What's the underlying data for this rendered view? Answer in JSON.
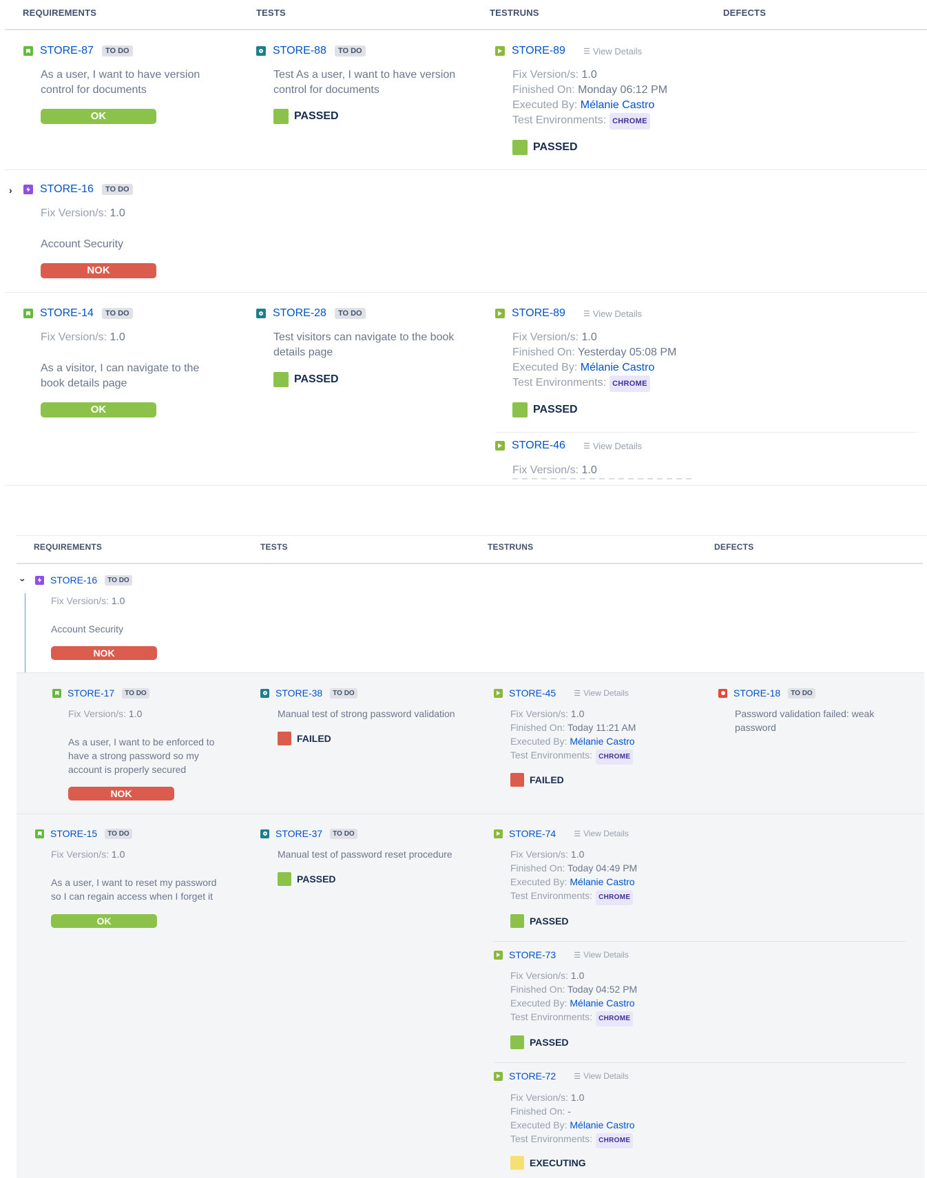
{
  "panel1": {
    "headers": {
      "requirements": "REQUIREMENTS",
      "tests": "TESTS",
      "testruns": "TESTRUNS",
      "defects": "DEFECTS"
    },
    "rows": [
      {
        "req": {
          "key": "STORE-87",
          "status": "TO DO",
          "text1": "As a user, I want to have version",
          "text2": "control for documents",
          "result": "OK"
        },
        "test": {
          "key": "STORE-88",
          "status": "TO DO",
          "text1": "Test As a user, I want to have version",
          "text2": "control for documents",
          "result": "PASSED"
        },
        "run": {
          "key": "STORE-89",
          "view": "View Details",
          "fix_label": "Fix Version/s:",
          "fix": "1.0",
          "fin_label": "Finished On:",
          "fin": "Monday 06:12 PM",
          "exec_label": "Executed By:",
          "user": "Mélanie Castro",
          "env_label": "Test Environments:",
          "env": "CHROME",
          "result": "PASSED"
        }
      },
      {
        "req": {
          "key": "STORE-16",
          "status": "TO DO",
          "fix_label": "Fix Version/s:",
          "fix": "1.0",
          "text1": "Account Security",
          "result": "NOK"
        }
      },
      {
        "req": {
          "key": "STORE-14",
          "status": "TO DO",
          "fix_label": "Fix Version/s:",
          "fix": "1.0",
          "text1": "As a visitor, I can navigate to the",
          "text2": "book details page",
          "result": "OK"
        },
        "test": {
          "key": "STORE-28",
          "status": "TO DO",
          "text1": "Test visitors can navigate to the book",
          "text2": "details page",
          "result": "PASSED"
        },
        "run": {
          "key": "STORE-89",
          "view": "View Details",
          "fix_label": "Fix Version/s:",
          "fix": "1.0",
          "fin_label": "Finished On:",
          "fin": "Yesterday 05:08 PM",
          "exec_label": "Executed By:",
          "user": "Mélanie Castro",
          "env_label": "Test Environments:",
          "env": "CHROME",
          "result": "PASSED"
        },
        "run2": {
          "key": "STORE-46",
          "view": "View Details",
          "fix_label": "Fix Version/s:",
          "fix": "1.0"
        }
      }
    ]
  },
  "panel2": {
    "headers": {
      "requirements": "REQUIREMENTS",
      "tests": "TESTS",
      "testruns": "TESTRUNS",
      "defects": "DEFECTS"
    },
    "epic": {
      "key": "STORE-16",
      "status": "TO DO",
      "fix_label": "Fix Version/s:",
      "fix": "1.0",
      "text1": "Account Security",
      "result": "NOK"
    },
    "row1": {
      "req": {
        "key": "STORE-17",
        "status": "TO DO",
        "fix_label": "Fix Version/s:",
        "fix": "1.0",
        "text1": "As a user, I want to be enforced to",
        "text2": "have a strong password so my",
        "text3": "account is properly secured",
        "result": "NOK"
      },
      "test": {
        "key": "STORE-38",
        "status": "TO DO",
        "text1": "Manual test of strong password validation",
        "result": "FAILED"
      },
      "run": {
        "key": "STORE-45",
        "view": "View Details",
        "fix_label": "Fix Version/s:",
        "fix": "1.0",
        "fin_label": "Finished On:",
        "fin": "Today 11:21 AM",
        "exec_label": "Executed By:",
        "user": "Mélanie Castro",
        "env_label": "Test Environments:",
        "env": "CHROME",
        "result": "FAILED"
      },
      "defect": {
        "key": "STORE-18",
        "status": "TO DO",
        "text1": "Password validation failed: weak",
        "text2": "password"
      }
    },
    "row2": {
      "req": {
        "key": "STORE-15",
        "status": "TO DO",
        "fix_label": "Fix Version/s:",
        "fix": "1.0",
        "text1": "As a user, I want to reset my password",
        "text2": "so I can regain access when I forget it",
        "result": "OK"
      },
      "test": {
        "key": "STORE-37",
        "status": "TO DO",
        "text1": "Manual test of password reset procedure",
        "result": "PASSED"
      },
      "runs": [
        {
          "key": "STORE-74",
          "view": "View Details",
          "fix_label": "Fix Version/s:",
          "fix": "1.0",
          "fin_label": "Finished On:",
          "fin": "Today 04:49 PM",
          "exec_label": "Executed By:",
          "user": "Mélanie Castro",
          "env_label": "Test Environments:",
          "env": "CHROME",
          "result": "PASSED"
        },
        {
          "key": "STORE-73",
          "view": "View Details",
          "fix_label": "Fix Version/s:",
          "fix": "1.0",
          "fin_label": "Finished On:",
          "fin": "Today 04:52 PM",
          "exec_label": "Executed By:",
          "user": "Mélanie Castro",
          "env_label": "Test Environments:",
          "env": "CHROME",
          "result": "PASSED"
        },
        {
          "key": "STORE-72",
          "view": "View Details",
          "fix_label": "Fix Version/s:",
          "fix": "1.0",
          "fin_label": "Finished On:",
          "fin": "-",
          "exec_label": "Executed By:",
          "user": "Mélanie Castro",
          "env_label": "Test Environments:",
          "env": "CHROME",
          "result": "EXECUTING"
        }
      ]
    }
  }
}
